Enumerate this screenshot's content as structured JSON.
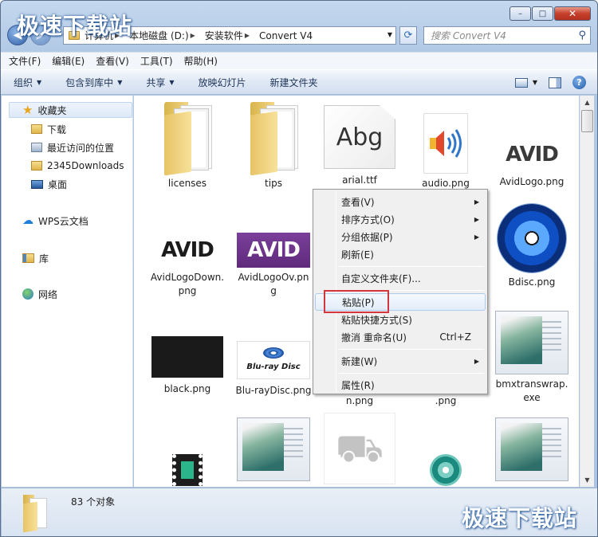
{
  "watermark": "极速下载站",
  "window": {
    "buttons": [
      "minimize",
      "maximize",
      "close"
    ]
  },
  "address": {
    "crumbs": [
      "计算机",
      "本地磁盘 (D:)",
      "安装软件",
      "Convert V4"
    ],
    "search_placeholder": "搜索 Convert V4"
  },
  "menubar": [
    "文件(F)",
    "编辑(E)",
    "查看(V)",
    "工具(T)",
    "帮助(H)"
  ],
  "toolbar": [
    "组织",
    "包含到库中",
    "共享",
    "放映幻灯片",
    "新建文件夹"
  ],
  "sidebar": {
    "favorites": "收藏夹",
    "fav_items": [
      "下载",
      "最近访问的位置",
      "2345Downloads",
      "桌面"
    ],
    "wps": "WPS云文档",
    "library": "库",
    "network": "网络"
  },
  "files": [
    {
      "name": "licenses",
      "icon": "folder-icon"
    },
    {
      "name": "tips",
      "icon": "folder-icon"
    },
    {
      "name": "arial.ttf",
      "icon": "font-file-icon",
      "glyph": "Abg"
    },
    {
      "name": "audio.png",
      "icon": "audio-icon"
    },
    {
      "name": "AvidLogo.png",
      "icon": "avid-logo-icon",
      "logo_text": "AVID"
    },
    {
      "name": "AvidLogoDown.png",
      "icon": "avid-logo-icon",
      "logo_text": "AVID"
    },
    {
      "name": "AvidLogoOv.png",
      "icon": "avid-logo-icon",
      "logo_text": "AVID"
    },
    {
      "name": "Bdisc.png",
      "icon": "disc-icon"
    },
    {
      "name": "black.png",
      "icon": "black-image-icon"
    },
    {
      "name": "Blu-rayDisc.png",
      "icon": "bluray-logo-icon",
      "logo_text": "Blu-ray Disc"
    },
    {
      "name": "n.png",
      "icon": "hidden-under-menu"
    },
    {
      "name": ".png",
      "icon": "hidden-under-menu"
    },
    {
      "name": "bmxtranswrap.exe",
      "icon": "application-window-icon"
    }
  ],
  "context_menu": {
    "items": [
      {
        "label": "查看(V)",
        "submenu": true
      },
      {
        "label": "排序方式(O)",
        "submenu": true
      },
      {
        "label": "分组依据(P)",
        "submenu": true
      },
      {
        "label": "刷新(E)"
      },
      {
        "label": "自定义文件夹(F)..."
      },
      {
        "label": "粘贴(P)",
        "highlighted": true
      },
      {
        "label": "粘贴快捷方式(S)"
      },
      {
        "label": "撤消 重命名(U)",
        "shortcut": "Ctrl+Z"
      },
      {
        "label": "新建(W)",
        "submenu": true
      },
      {
        "label": "属性(R)"
      }
    ]
  },
  "status": {
    "count_text": "83 个对象"
  },
  "colors": {
    "highlight_box": "#d4373b",
    "accent": "#2d5fa8"
  }
}
